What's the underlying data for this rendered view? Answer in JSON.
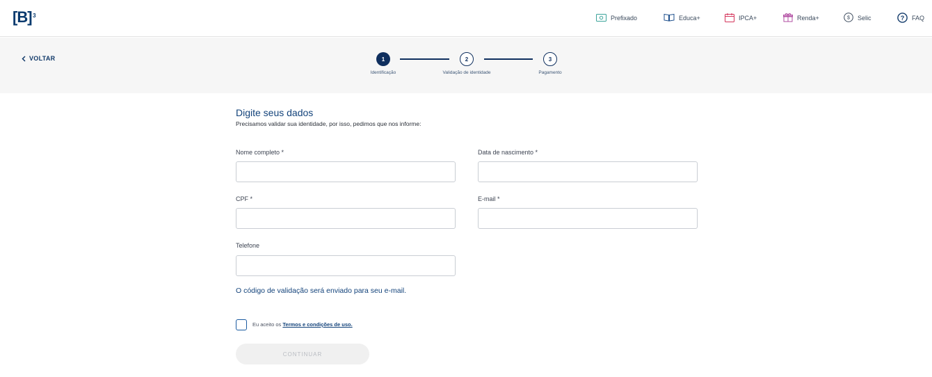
{
  "header": {
    "logo_text": "[B]",
    "logo_sup": "3",
    "nav": [
      {
        "label": "Prefixado",
        "icon": "money-bill-icon"
      },
      {
        "label": "Educa+",
        "icon": "open-book-icon"
      },
      {
        "label": "IPCA+",
        "icon": "calendar-icon"
      },
      {
        "label": "Renda+",
        "icon": "gift-icon"
      },
      {
        "label": "Selic",
        "icon": "dollar-coin-icon"
      },
      {
        "label": "FAQ",
        "icon": "question-circle-icon"
      }
    ]
  },
  "steps": {
    "back_label": "VOLTAR",
    "items": [
      {
        "number": "1",
        "label": "Identificação",
        "state": "active"
      },
      {
        "number": "2",
        "label": "Validação de identidade",
        "state": "idle"
      },
      {
        "number": "3",
        "label": "Pagamento",
        "state": "idle"
      }
    ]
  },
  "form": {
    "title": "Digite seus dados",
    "subtitle": "Precisamos validar sua identidade, por isso, pedimos que nos informe:",
    "fields": {
      "name_label": "Nome completo *",
      "name_value": "",
      "birth_label": "Data de nascimento *",
      "birth_value": "",
      "cpf_label": "CPF *",
      "cpf_value": "",
      "email_label": "E-mail *",
      "email_value": "",
      "phone_label": "Telefone",
      "phone_value": ""
    },
    "notice": "O código de validação será enviado para seu e-mail.",
    "terms_prefix": "Eu aceito os",
    "terms_link": "Termos e condições de uso.",
    "continue_label": "CONTINUAR"
  },
  "colors": {
    "brand": "#0f2f5e",
    "link": "#12427a",
    "band": "#f6f6f6"
  }
}
